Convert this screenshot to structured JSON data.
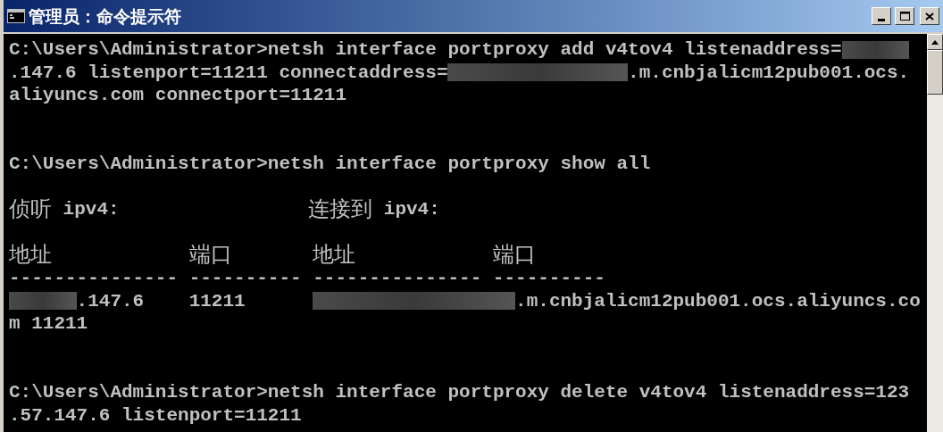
{
  "window": {
    "title": "管理员：命令提示符"
  },
  "console": {
    "lines": [
      {
        "kind": "plain",
        "segments": [
          {
            "kind": "text",
            "text": "C:\\Users\\Administrator>netsh interface portproxy add v4tov4 listenaddress="
          },
          {
            "kind": "redacted"
          }
        ]
      },
      {
        "kind": "plain",
        "segments": [
          {
            "kind": "text",
            "text": ".147.6 listenport=11211 connectaddress="
          },
          {
            "kind": "redacted"
          },
          {
            "kind": "text",
            "text": ".m.cnbjalicm12pub001.ocs."
          }
        ]
      },
      {
        "kind": "plain",
        "segments": [
          {
            "kind": "text",
            "text": "aliyuncs.com connectport=11211"
          }
        ]
      },
      {
        "kind": "blank"
      },
      {
        "kind": "blank"
      },
      {
        "kind": "plain",
        "segments": [
          {
            "kind": "text",
            "text": "C:\\Users\\Administrator>netsh interface portproxy show all"
          }
        ]
      },
      {
        "kind": "blank"
      },
      {
        "kind": "section",
        "cells": [
          {
            "segments": [
              {
                "kind": "cjk",
                "text": "侦听"
              },
              {
                "kind": "text",
                "text": " ipv4:"
              }
            ]
          },
          {
            "segments": [
              {
                "kind": "cjk",
                "text": "连接到"
              },
              {
                "kind": "text",
                "text": " ipv4:"
              }
            ]
          }
        ]
      },
      {
        "kind": "blank"
      },
      {
        "kind": "table",
        "cells": [
          {
            "segments": [
              {
                "kind": "cjk",
                "text": "地址"
              }
            ]
          },
          {
            "segments": [
              {
                "kind": "cjk",
                "text": "端口"
              }
            ]
          },
          {
            "segments": [
              {
                "kind": "cjk",
                "text": "地址"
              }
            ]
          },
          {
            "segments": [
              {
                "kind": "cjk",
                "text": "端口"
              }
            ]
          }
        ]
      },
      {
        "kind": "table",
        "cells": [
          {
            "segments": [
              {
                "kind": "text",
                "text": "---------------"
              }
            ]
          },
          {
            "segments": [
              {
                "kind": "text",
                "text": "----------"
              }
            ]
          },
          {
            "segments": [
              {
                "kind": "text",
                "text": "---------------"
              }
            ]
          },
          {
            "segments": [
              {
                "kind": "text",
                "text": "----------"
              }
            ]
          }
        ]
      },
      {
        "kind": "table",
        "cells": [
          {
            "segments": [
              {
                "kind": "redacted"
              },
              {
                "kind": "text",
                "text": ".147.6"
              }
            ]
          },
          {
            "segments": [
              {
                "kind": "text",
                "text": "11211"
              }
            ]
          },
          {
            "segments": [
              {
                "kind": "redacted"
              },
              {
                "kind": "text",
                "text": ".m.cnbjalicm12pub001.ocs.aliyuncs.co"
              }
            ]
          }
        ]
      },
      {
        "kind": "plain",
        "segments": [
          {
            "kind": "text",
            "text": "m 11211"
          }
        ]
      },
      {
        "kind": "blank"
      },
      {
        "kind": "blank"
      },
      {
        "kind": "plain",
        "segments": [
          {
            "kind": "text",
            "text": "C:\\Users\\Administrator>netsh interface portproxy delete v4tov4 listenaddress=123"
          }
        ]
      },
      {
        "kind": "plain",
        "segments": [
          {
            "kind": "text",
            "text": ".57.147.6 listenport=11211"
          }
        ]
      }
    ]
  }
}
